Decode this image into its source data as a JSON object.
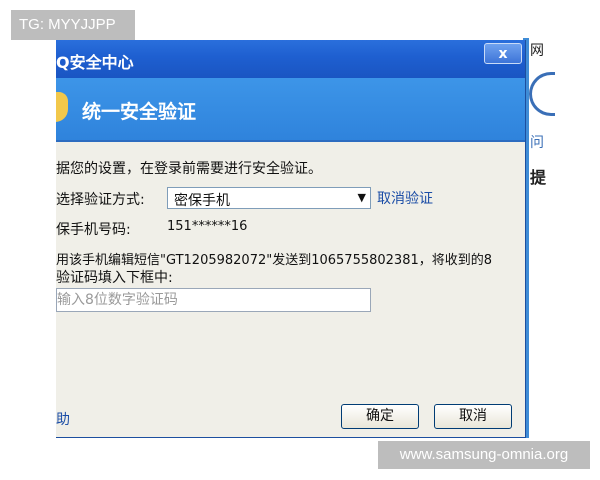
{
  "watermarks": {
    "top": "TG: MYYJJPP",
    "bottom": "www.samsung-omnia.org"
  },
  "background_window": {
    "title_fragment": "网",
    "link_fragment": "问",
    "bold_fragment": "提"
  },
  "dialog": {
    "title": "Q安全中心",
    "close_label": "x",
    "banner_title": "统一安全验证",
    "intro": "据您的设置，在登录前需要进行安全验证。",
    "method_label": "选择验证方式:",
    "method_value": "密保手机",
    "cancel_verify_link": "取消验证",
    "phone_label": "保手机号码:",
    "phone_value": "151******16",
    "instruction_line1": "用该手机编辑短信\"GT1205982072\"发送到1065755802381，将收到的8",
    "instruction_line2": "验证码填入下框中:",
    "code_input": {
      "value": "",
      "placeholder": "输入8位数字验证码"
    },
    "help_link": "助",
    "ok_button": "确定",
    "cancel_button": "取消"
  },
  "colors": {
    "titlebar": "#1e5fd0",
    "banner": "#3d95e8",
    "dialog_body": "#f0efe8",
    "link": "#1b4da6"
  }
}
